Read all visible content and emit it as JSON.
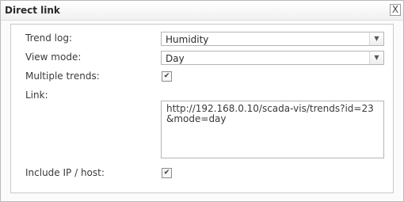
{
  "dialog": {
    "title": "Direct link",
    "close_symbol": "X"
  },
  "form": {
    "trend_log": {
      "label": "Trend log:",
      "value": "Humidity"
    },
    "view_mode": {
      "label": "View mode:",
      "value": "Day"
    },
    "multiple_trends": {
      "label": "Multiple trends:",
      "checked": true
    },
    "link": {
      "label": "Link:",
      "value": "http://192.168.0.10/scada-vis/trends?id=23&mode=day"
    },
    "include_host": {
      "label": "Include IP / host:",
      "checked": true
    }
  },
  "icons": {
    "dropdown": "chevron-down-icon",
    "check": "checkmark-icon",
    "close": "close-icon"
  }
}
